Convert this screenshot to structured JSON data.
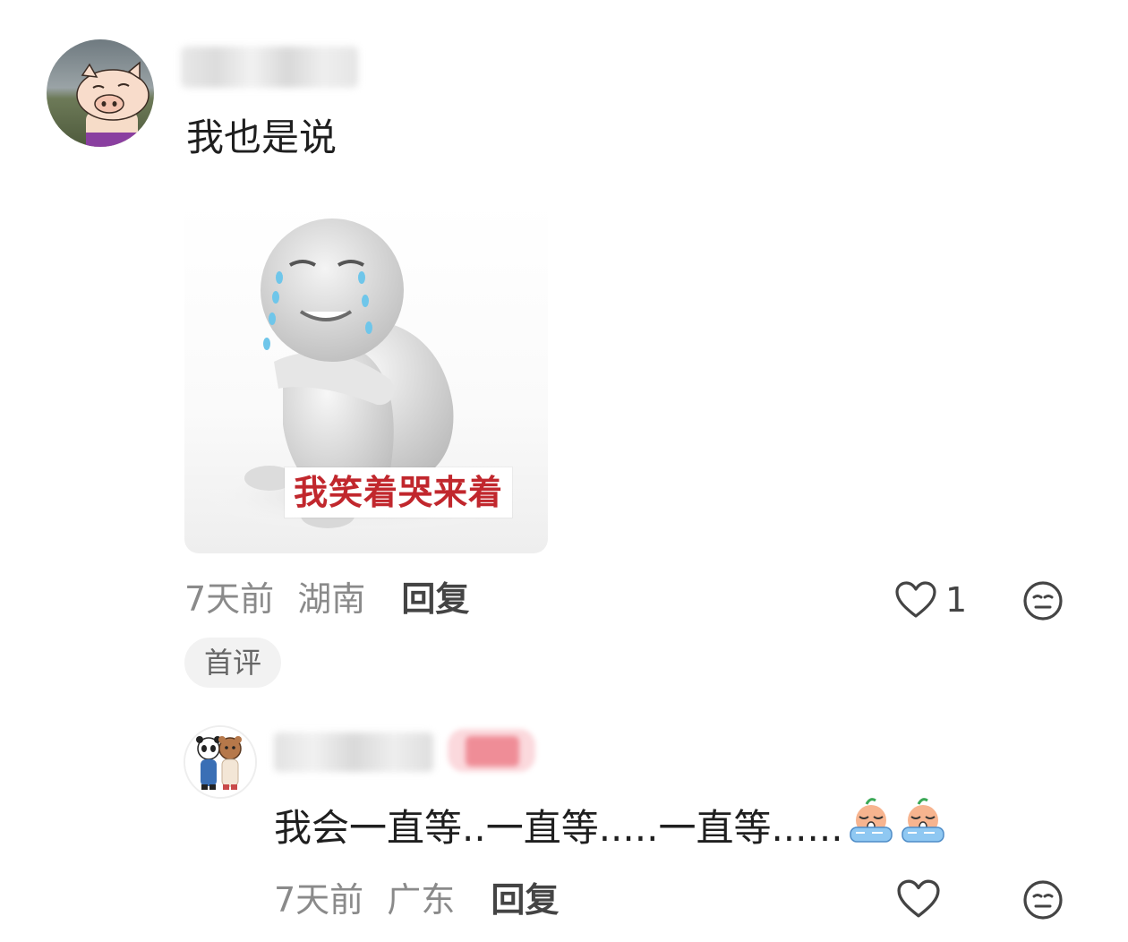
{
  "comments": [
    {
      "author_name": "",
      "text": "我也是说",
      "sticker": {
        "icon": "crying-smiling-figure-sticker",
        "caption": "我笑着哭来着"
      },
      "time": "7天前",
      "location": "湖南",
      "reply_label": "回复",
      "like_count": "1",
      "tag": "首评",
      "icons": {
        "avatar": "cartoon-pig-avatar",
        "like": "heart-outline-icon",
        "dislike": "neutral-face-icon"
      }
    },
    {
      "author_name": "",
      "text": "我会一直等..一直等.....一直等......",
      "emojis": [
        "crying-emoji",
        "crying-emoji"
      ],
      "time": "7天前",
      "location": "广东",
      "reply_label": "回复",
      "like_count": "",
      "icons": {
        "avatar": "panda-and-bear-avatar",
        "like": "heart-outline-icon",
        "dislike": "neutral-face-icon"
      }
    }
  ],
  "colors": {
    "meta_text": "#8a8a8a",
    "reply_text": "#444444",
    "caption_red": "#c1272d",
    "tag_bg": "#f2f2f2"
  }
}
